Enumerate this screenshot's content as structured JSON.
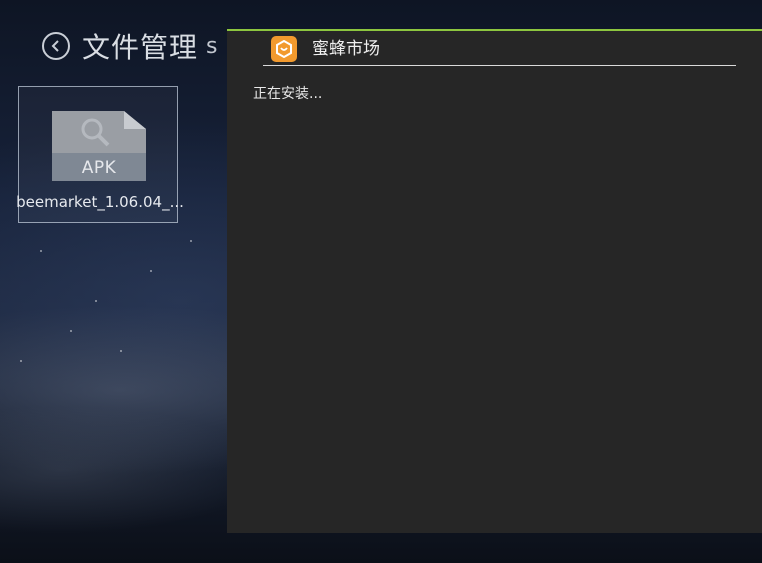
{
  "background_app": {
    "title": "文件管理",
    "path_fragment": "s",
    "file": {
      "type_label": "APK",
      "name": "beemarket_1.06.04_..."
    }
  },
  "dialog": {
    "title": "蜜蜂市场",
    "icon": "beemarket-app-icon",
    "status": "正在安装...",
    "accent_color": "#8dc63f"
  }
}
